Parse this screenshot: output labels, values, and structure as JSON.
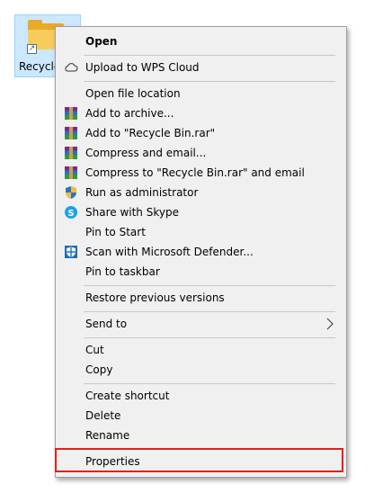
{
  "desktop_icon": {
    "label": "Recycle"
  },
  "menu": {
    "open": "Open",
    "upload_wps": "Upload to WPS Cloud",
    "open_file_location": "Open file location",
    "add_archive": "Add to archive...",
    "add_rar": "Add to \"Recycle Bin.rar\"",
    "compress_email": "Compress and email...",
    "compress_rar_email": "Compress to \"Recycle Bin.rar\" and email",
    "run_admin": "Run as administrator",
    "share_skype": "Share with Skype",
    "pin_start": "Pin to Start",
    "scan_defender": "Scan with Microsoft Defender...",
    "pin_taskbar": "Pin to taskbar",
    "restore_versions": "Restore previous versions",
    "send_to": "Send to",
    "cut": "Cut",
    "copy": "Copy",
    "create_shortcut": "Create shortcut",
    "delete": "Delete",
    "rename": "Rename",
    "properties": "Properties"
  },
  "colors": {
    "highlight": "#e81e1e",
    "menu_bg": "#f0f0f0",
    "skype": "#1aa3e8",
    "defender": "#1f6fb5"
  },
  "icons": [
    "folder-icon",
    "shortcut-arrow-icon",
    "cloud-icon",
    "winrar-icon",
    "shield-icon",
    "skype-icon",
    "defender-icon",
    "chevron-right-icon"
  ]
}
